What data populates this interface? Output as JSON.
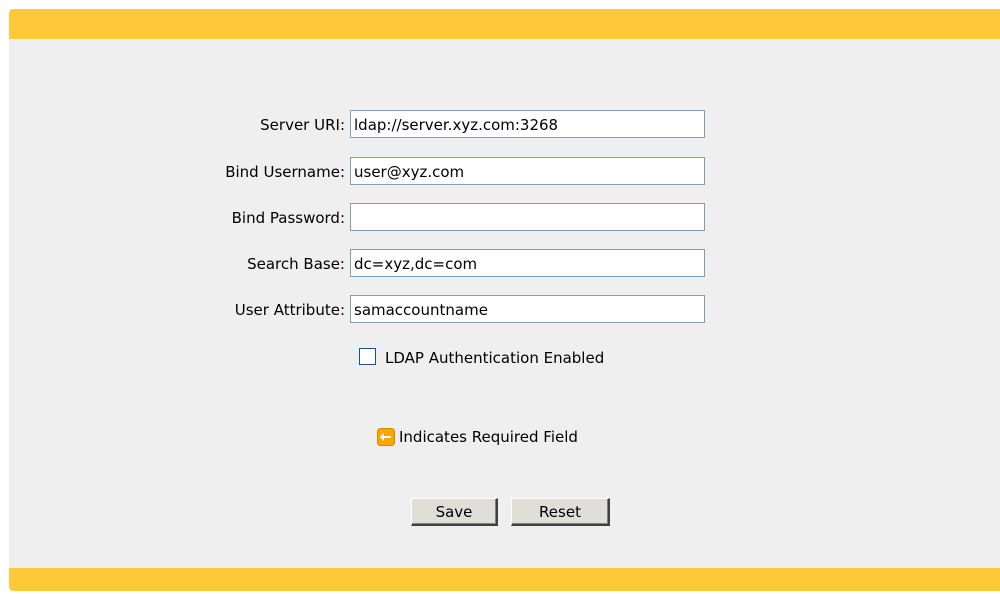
{
  "form": {
    "fields": [
      {
        "label": "Server URI:",
        "value": "ldap://server.xyz.com:3268"
      },
      {
        "label": "Bind Username:",
        "value": "user@xyz.com"
      },
      {
        "label": "Bind Password:",
        "value": ""
      },
      {
        "label": "Search Base:",
        "value": "dc=xyz,dc=com"
      },
      {
        "label": "User Attribute:",
        "value": "samaccountname"
      }
    ],
    "ldap_enabled": {
      "label": "LDAP Authentication Enabled",
      "checked": false
    },
    "required_note": {
      "text": "Indicates Required Field",
      "icon": "required-arrow-icon"
    },
    "buttons": {
      "save_label": "Save",
      "reset_label": "Reset"
    }
  },
  "colors": {
    "accent_bar": "#fdc93b",
    "panel_background": "#efefef",
    "required_icon": "#f5a800"
  }
}
